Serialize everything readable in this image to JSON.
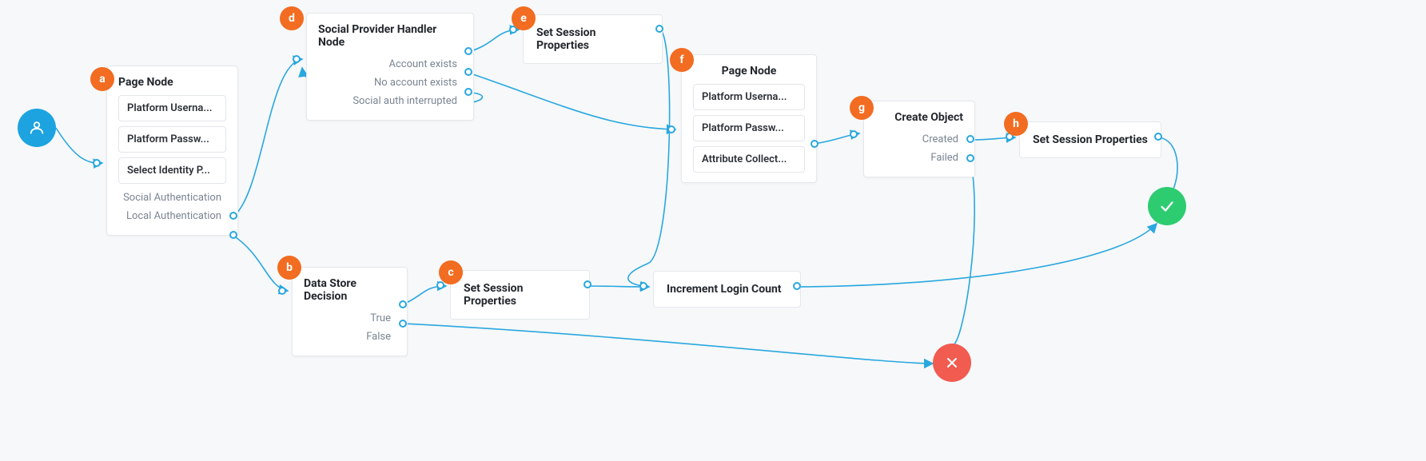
{
  "colors": {
    "accent": "#29a7df",
    "badge": "#f26c21",
    "success": "#2ecc71",
    "fail": "#f15b50"
  },
  "start": {
    "icon": "user-icon"
  },
  "nodes": {
    "a": {
      "badge": "a",
      "title": "Page Node",
      "items": [
        "Platform Userna...",
        "Platform Passw...",
        "Select Identity P..."
      ],
      "outcomes": [
        "Social Authentication",
        "Local Authentication"
      ]
    },
    "d": {
      "badge": "d",
      "title": "Social Provider Handler Node",
      "outcomes": [
        "Account exists",
        "No account exists",
        "Social auth interrupted"
      ]
    },
    "e": {
      "badge": "e",
      "title": "Set Session Properties"
    },
    "b": {
      "badge": "b",
      "title": "Data Store Decision",
      "outcomes": [
        "True",
        "False"
      ]
    },
    "c": {
      "badge": "c",
      "title": "Set Session Properties"
    },
    "increment": {
      "title": "Increment Login Count"
    },
    "f": {
      "badge": "f",
      "title": "Page Node",
      "items": [
        "Platform Userna...",
        "Platform Passw...",
        "Attribute Collect..."
      ]
    },
    "g": {
      "badge": "g",
      "title": "Create Object",
      "outcomes": [
        "Created",
        "Failed"
      ]
    },
    "h": {
      "badge": "h",
      "title": "Set Session Properties"
    }
  },
  "end": {
    "success_icon": "check-icon",
    "fail_icon": "close-icon"
  }
}
